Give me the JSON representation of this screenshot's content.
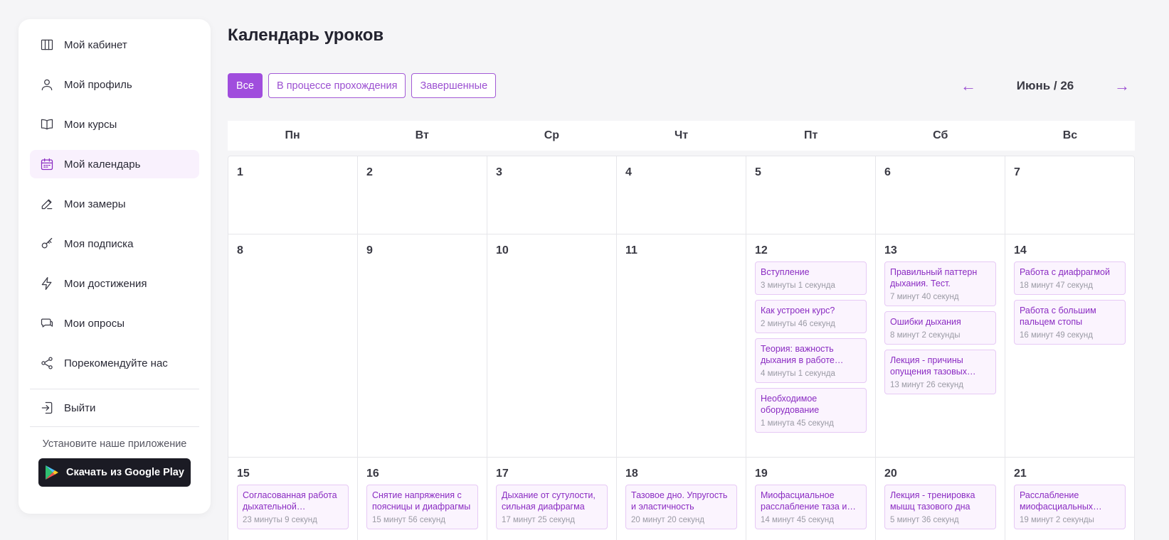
{
  "sidebar": {
    "items": [
      {
        "label": "Мой кабинет",
        "icon": "columns-icon"
      },
      {
        "label": "Мой профиль",
        "icon": "user-icon"
      },
      {
        "label": "Мои курсы",
        "icon": "book-icon"
      },
      {
        "label": "Мой календарь",
        "icon": "calendar-icon"
      },
      {
        "label": "Мои замеры",
        "icon": "edit-icon"
      },
      {
        "label": "Моя подписка",
        "icon": "key-icon"
      },
      {
        "label": "Мои достижения",
        "icon": "lightning-icon"
      },
      {
        "label": "Мои опросы",
        "icon": "chat-icon"
      },
      {
        "label": "Порекомендуйте нас",
        "icon": "share-icon"
      }
    ],
    "active_index": 3,
    "logout_label": "Выйти",
    "install_label": "Установите наше приложение",
    "google_play_label": "Скачать из Google Play"
  },
  "main": {
    "title": "Календарь уроков",
    "filters": [
      "Все",
      "В процессе прохождения",
      "Завершенные"
    ],
    "active_filter": 0,
    "month_label": "Июнь / 26",
    "prev_arrow": "←",
    "next_arrow": "→",
    "weekdays": [
      "Пн",
      "Вт",
      "Ср",
      "Чт",
      "Пт",
      "Сб",
      "Вс"
    ],
    "weeks": [
      [
        {
          "day": "1",
          "lessons": []
        },
        {
          "day": "2",
          "lessons": []
        },
        {
          "day": "3",
          "lessons": []
        },
        {
          "day": "4",
          "lessons": []
        },
        {
          "day": "5",
          "lessons": []
        },
        {
          "day": "6",
          "lessons": []
        },
        {
          "day": "7",
          "lessons": []
        }
      ],
      [
        {
          "day": "8",
          "lessons": []
        },
        {
          "day": "9",
          "lessons": []
        },
        {
          "day": "10",
          "lessons": []
        },
        {
          "day": "11",
          "lessons": []
        },
        {
          "day": "12",
          "lessons": [
            {
              "title": "Вступление",
              "duration": "3 минуты 1 секунда"
            },
            {
              "title": "Как устроен курс?",
              "duration": "2 минуты 46 секунд"
            },
            {
              "title": "Теория: важность дыхания в работе мышц",
              "duration": "4 минуты 1 секунда"
            },
            {
              "title": "Необходимое оборудование",
              "duration": "1 минута 45 секунд"
            }
          ]
        },
        {
          "day": "13",
          "lessons": [
            {
              "title": "Правильный паттерн дыхания. Тест.",
              "duration": "7 минут 40 секунд"
            },
            {
              "title": "Ошибки дыхания",
              "duration": "8 минут 2 секунды"
            },
            {
              "title": "Лекция - причины опущения тазовых органов",
              "duration": "13 минут 26 секунд"
            }
          ]
        },
        {
          "day": "14",
          "lessons": [
            {
              "title": "Работа с диафрагмой",
              "duration": "18 минут 47 секунд"
            },
            {
              "title": "Работа с большим пальцем стопы",
              "duration": "16 минут 49 секунд"
            }
          ]
        }
      ],
      [
        {
          "day": "15",
          "lessons": [
            {
              "title": "Согласованная работа дыхательной диафрагмы",
              "duration": "23 минуты 9 секунд"
            }
          ]
        },
        {
          "day": "16",
          "lessons": [
            {
              "title": "Снятие напряжения с поясницы и диафрагмы",
              "duration": "15 минут 56 секунд"
            }
          ]
        },
        {
          "day": "17",
          "lessons": [
            {
              "title": "Дыхание от сутулости, сильная диафрагма",
              "duration": "17 минут 25 секунд"
            }
          ]
        },
        {
          "day": "18",
          "lessons": [
            {
              "title": "Тазовое дно. Упругость и эластичность",
              "duration": "20 минут 20 секунд"
            }
          ]
        },
        {
          "day": "19",
          "lessons": [
            {
              "title": "Миофасциальное расслабление таза и бедер",
              "duration": "14 минут 45 секунд"
            }
          ]
        },
        {
          "day": "20",
          "lessons": [
            {
              "title": "Лекция - тренировка мышц тазового дна",
              "duration": "5 минут 36 секунд"
            }
          ]
        },
        {
          "day": "21",
          "lessons": [
            {
              "title": "Расслабление миофасциальных структур",
              "duration": "19 минут 2 секунды"
            }
          ]
        }
      ]
    ]
  },
  "colors": {
    "accent": "#a04ddd",
    "lesson_bg": "#fbf4fe",
    "lesson_border": "#e6c9f5",
    "active_nav_bg": "#f9f1fd"
  }
}
